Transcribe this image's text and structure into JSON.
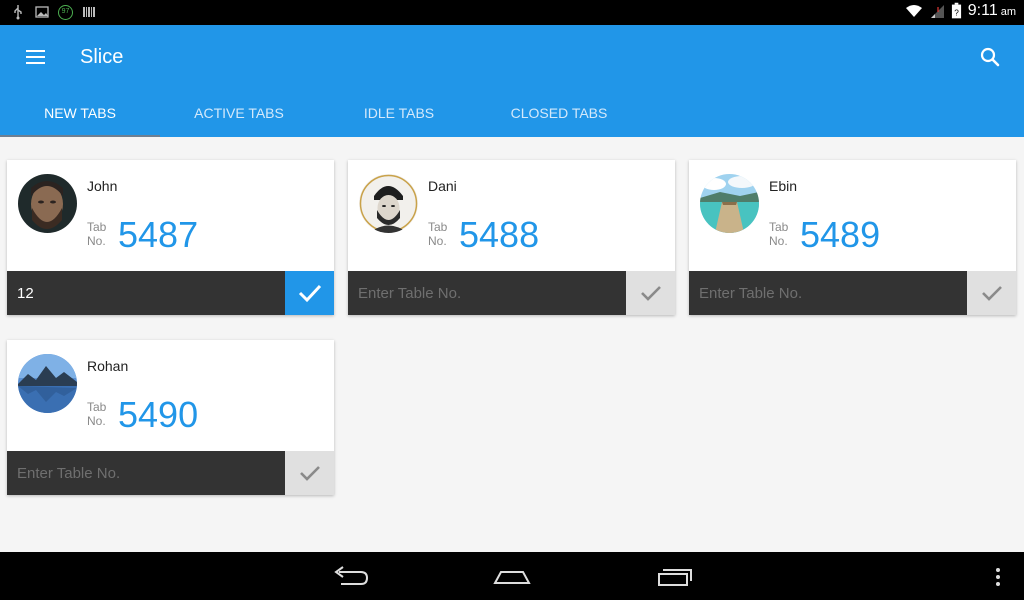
{
  "statusbar": {
    "battery_level": "97",
    "time": "9:11",
    "ampm": "am",
    "icons": [
      "usb-icon",
      "image-icon",
      "battery-percent-icon",
      "barcode-icon",
      "wifi-icon",
      "signal-icon",
      "battery-icon"
    ]
  },
  "appbar": {
    "title": "Slice",
    "color": "#2196e8"
  },
  "tabs": [
    {
      "label": "NEW TABS",
      "active": true
    },
    {
      "label": "ACTIVE TABS",
      "active": false
    },
    {
      "label": "IDLE TABS",
      "active": false
    },
    {
      "label": "CLOSED TABS",
      "active": false
    }
  ],
  "cards": [
    {
      "name": "John",
      "tab_label": "Tab No.",
      "tab_number": "5487",
      "input_value": "12",
      "placeholder": "Enter Table No.",
      "confirm_active": true,
      "avatar": "bearded-man-photo"
    },
    {
      "name": "Dani",
      "tab_label": "Tab No.",
      "tab_number": "5488",
      "input_value": "",
      "placeholder": "Enter Table No.",
      "confirm_active": false,
      "avatar": "man-beanie-sketch"
    },
    {
      "name": "Ebin",
      "tab_label": "Tab No.",
      "tab_number": "5489",
      "input_value": "",
      "placeholder": "Enter Table No.",
      "confirm_active": false,
      "avatar": "tropical-pier-photo"
    },
    {
      "name": "Rohan",
      "tab_label": "Tab No.",
      "tab_number": "5490",
      "input_value": "",
      "placeholder": "Enter Table No.",
      "confirm_active": false,
      "avatar": "mountain-lake-photo"
    }
  ],
  "navbar": {
    "icons": [
      "back-icon",
      "home-icon",
      "recents-icon",
      "overflow-menu-icon"
    ]
  }
}
